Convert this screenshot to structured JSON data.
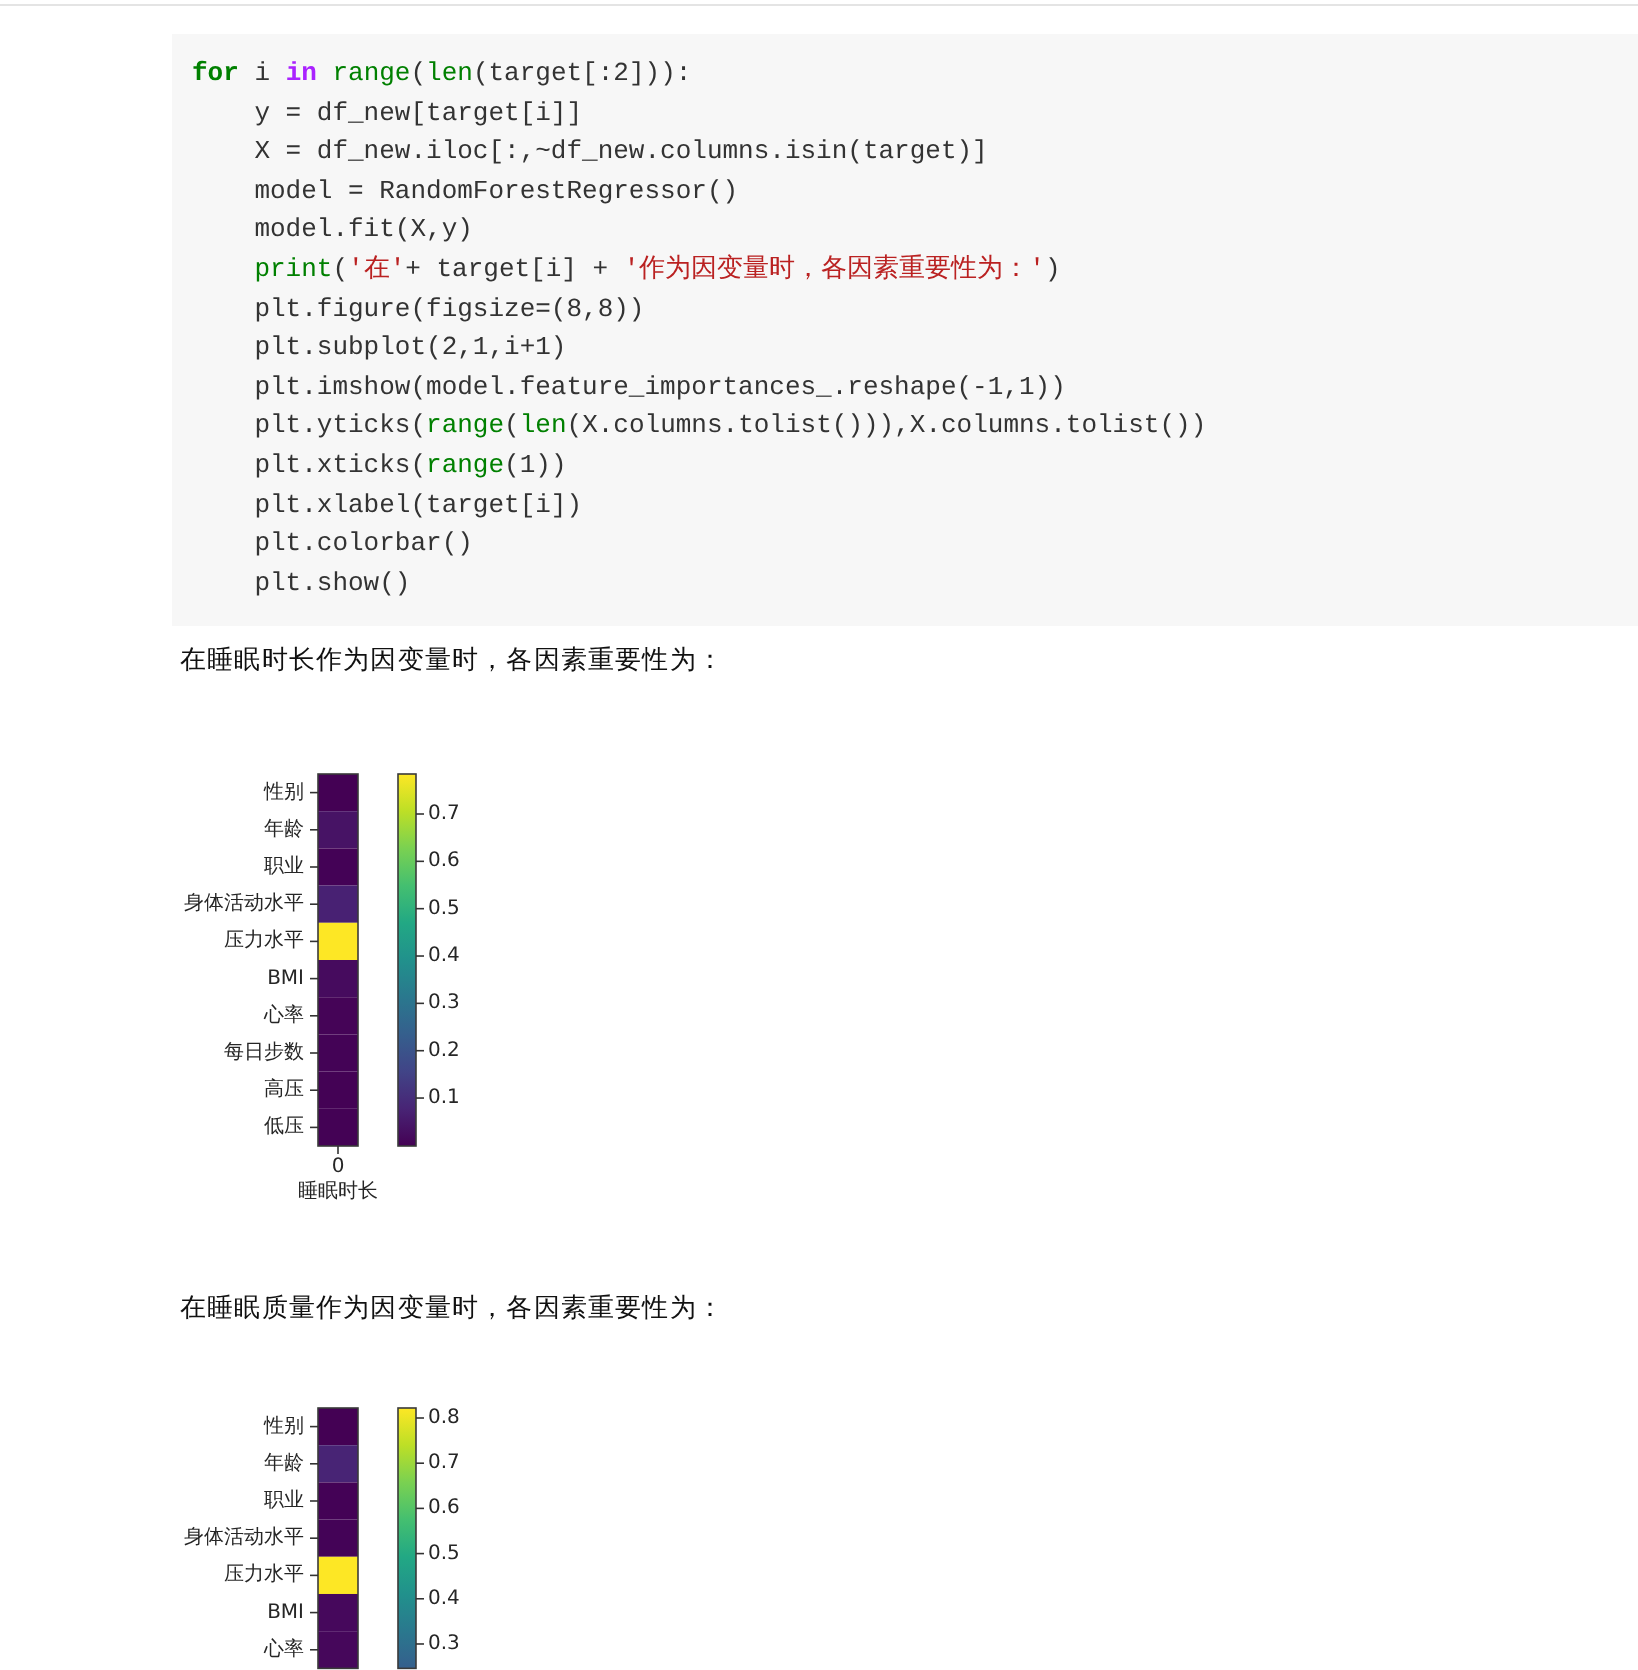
{
  "code_cell": {
    "lines": [
      {
        "tokens": [
          {
            "kind": "keyword",
            "text": "for"
          },
          {
            "kind": "plain",
            "text": " i "
          },
          {
            "kind": "operator",
            "text": "in "
          },
          {
            "kind": "builtin",
            "text": "range"
          },
          {
            "kind": "plain",
            "text": "("
          },
          {
            "kind": "builtin",
            "text": "len"
          },
          {
            "kind": "plain",
            "text": "(target[:2])):"
          }
        ],
        "children": [
          {
            "tokens": [
              {
                "kind": "plain",
                "text": "y = df_new[target[i]]"
              }
            ]
          },
          {
            "tokens": [
              {
                "kind": "plain",
                "text": "X = df_new.iloc[:,~df_new.columns.isin(target)]"
              }
            ]
          },
          {
            "tokens": [
              {
                "kind": "plain",
                "text": "model = RandomForestRegressor()"
              }
            ]
          },
          {
            "tokens": [
              {
                "kind": "plain",
                "text": "model.fit(X,y)"
              }
            ]
          },
          {
            "tokens": [
              {
                "kind": "builtin",
                "text": "print"
              },
              {
                "kind": "plain",
                "text": "("
              },
              {
                "kind": "string",
                "text": "'在'"
              },
              {
                "kind": "plain",
                "text": "+ target[i] + "
              },
              {
                "kind": "string",
                "text": "'作为因变量时，各因素重要性为：'"
              },
              {
                "kind": "plain",
                "text": ")"
              }
            ]
          },
          {
            "tokens": [
              {
                "kind": "plain",
                "text": "plt.figure(figsize=(8,8))"
              }
            ]
          },
          {
            "tokens": [
              {
                "kind": "plain",
                "text": "plt.subplot(2,1,i+1)"
              }
            ]
          },
          {
            "tokens": [
              {
                "kind": "plain",
                "text": "plt.imshow(model.feature_importances_.reshape(-1,1))"
              }
            ]
          },
          {
            "tokens": [
              {
                "kind": "plain",
                "text": "plt.yticks("
              },
              {
                "kind": "builtin",
                "text": "range"
              },
              {
                "kind": "plain",
                "text": "("
              },
              {
                "kind": "builtin",
                "text": "len"
              },
              {
                "kind": "plain",
                "text": "(X.columns.tolist())),X.columns.tolist())"
              }
            ]
          },
          {
            "tokens": [
              {
                "kind": "plain",
                "text": "plt.xticks("
              },
              {
                "kind": "builtin",
                "text": "range"
              },
              {
                "kind": "plain",
                "text": "(1))"
              }
            ]
          },
          {
            "tokens": [
              {
                "kind": "plain",
                "text": "plt.xlabel(target[i])"
              }
            ]
          },
          {
            "tokens": [
              {
                "kind": "plain",
                "text": "plt.colorbar()"
              }
            ]
          },
          {
            "tokens": [
              {
                "kind": "plain",
                "text": "plt.show()"
              }
            ]
          }
        ]
      }
    ]
  },
  "outputs": [
    {
      "text": "在睡眠时长作为因变量时，各因素重要性为：",
      "heatmap": {
        "rows": [
          {
            "label": "性别",
            "color": "#440154"
          },
          {
            "label": "年龄",
            "color": "#471365"
          },
          {
            "label": "职业",
            "color": "#440256"
          },
          {
            "label": "身体活动水平",
            "color": "#482173"
          },
          {
            "label": "压力水平",
            "color": "#fde725"
          },
          {
            "label": "BMI",
            "color": "#460b5e"
          },
          {
            "label": "心率",
            "color": "#450457"
          },
          {
            "label": "每日步数",
            "color": "#440356"
          },
          {
            "label": "高压",
            "color": "#440255"
          },
          {
            "label": "低压",
            "color": "#440255"
          }
        ],
        "colorbar_ticks": [
          "0.7",
          "0.6",
          "0.5",
          "0.4",
          "0.3",
          "0.2",
          "0.1"
        ],
        "xtick": "0",
        "xlabel": "睡眠时长"
      }
    },
    {
      "text": "在睡眠质量作为因变量时，各因素重要性为：",
      "heatmap": {
        "rows": [
          {
            "label": "性别",
            "color": "#440154"
          },
          {
            "label": "年龄",
            "color": "#482475"
          },
          {
            "label": "职业",
            "color": "#440256"
          },
          {
            "label": "身体活动水平",
            "color": "#440357"
          },
          {
            "label": "压力水平",
            "color": "#fde725"
          },
          {
            "label": "BMI",
            "color": "#46085c"
          },
          {
            "label": "心率",
            "color": "#46075b"
          }
        ],
        "colorbar_ticks": [
          "0.8",
          "0.7",
          "0.6",
          "0.5",
          "0.4",
          "0.3"
        ]
      }
    }
  ]
}
